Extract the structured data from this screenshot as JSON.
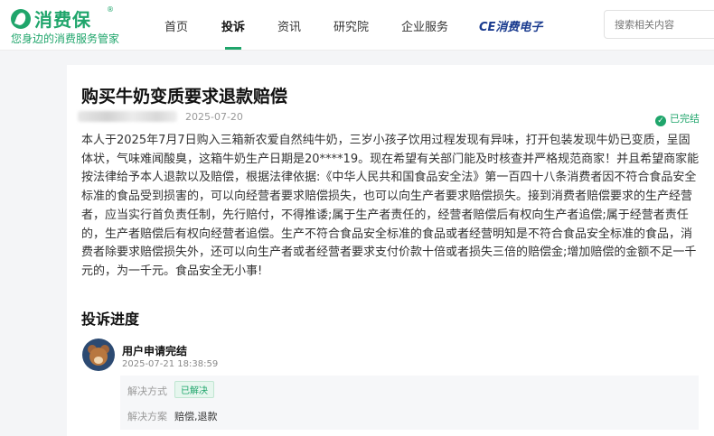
{
  "logo": {
    "name": "消费保",
    "reg_mark": "®",
    "slogan": "您身边的消费服务管家"
  },
  "nav": {
    "items": [
      "首页",
      "投诉",
      "资讯",
      "研究院",
      "企业服务"
    ],
    "active_index": 1,
    "ce_logo": "CE消费电子"
  },
  "search": {
    "placeholder": "搜索相关内容"
  },
  "complaint": {
    "title": "购买牛奶变质要求退款赔偿",
    "date": "2025-07-20",
    "status": "已完结",
    "body": "本人于2025年7月7日购入三箱新农爱自然纯牛奶，三岁小孩子饮用过程发现有异味，打开包装发现牛奶已变质，呈固体状，气味难闻酸臭，这箱牛奶生产日期是20****19。现在希望有关部门能及时核查并严格规范商家！并且希望商家能按法律给予本人退款以及赔偿，根据法律依据:《中华人民共和国食品安全法》第一百四十八条消费者因不符合食品安全标准的食品受到损害的，可以向经营者要求赔偿损失，也可以向生产者要求赔偿损失。接到消费者赔偿要求的生产经营者，应当实行首负责任制，先行赔付，不得推诿;属于生产者责任的，经营者赔偿后有权向生产者追偿;属于经营者责任的，生产者赔偿后有权向经营者追偿。生产不符合食品安全标准的食品或者经营明知是不符合食品安全标准的食品，消费者除要求赔偿损失外，还可以向生产者或者经营者要求支付价款十倍或者损失三倍的赔偿金;增加赔偿的金额不足一千元的，为一千元。食品安全无小事!"
  },
  "progress": {
    "section_title": "投诉进度",
    "step": {
      "title": "用户申请完结",
      "time": "2025-07-21 18:38:59",
      "method_label": "解决方式",
      "method_value": "已解决",
      "plan_label": "解决方案",
      "plan_value": "赔偿,退款"
    }
  },
  "colors": {
    "brand": "#1fa56b",
    "ce_blue": "#1a3b8f"
  }
}
